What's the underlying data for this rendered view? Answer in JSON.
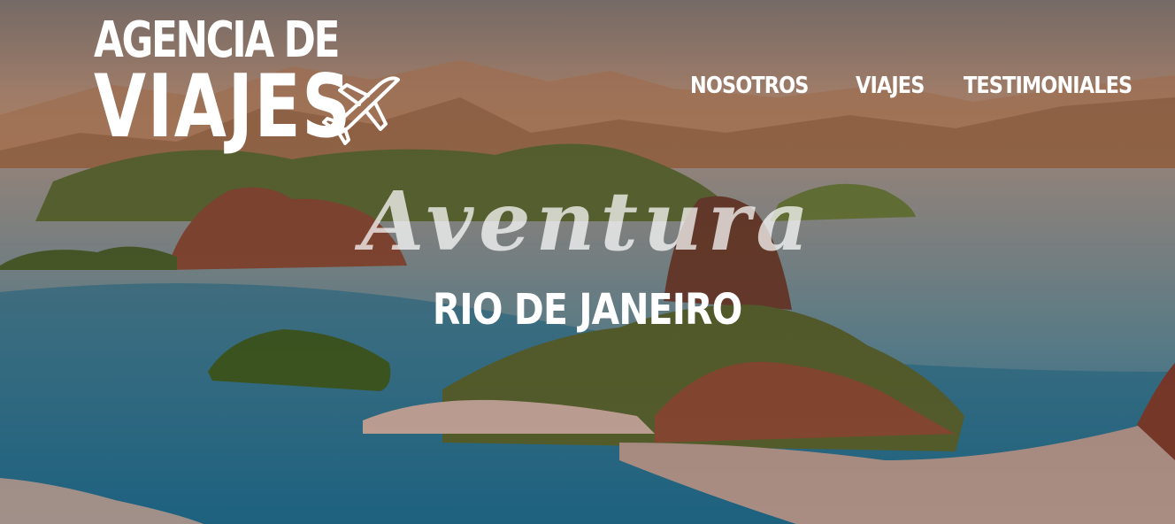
{
  "header": {
    "logo": {
      "line1": "AGENCIA DE",
      "line2": "VIAJES",
      "icon": "airplane-icon"
    },
    "nav": [
      {
        "label": "NOSOTROS"
      },
      {
        "label": "VIAJES"
      },
      {
        "label": "TESTIMONIALES"
      }
    ]
  },
  "hero": {
    "tagline": "Aventura",
    "destination": "RIO DE JANEIRO"
  },
  "colors": {
    "text": "#ffffff",
    "sky_warm": "#d98a5a",
    "water": "#2f6f8a"
  }
}
